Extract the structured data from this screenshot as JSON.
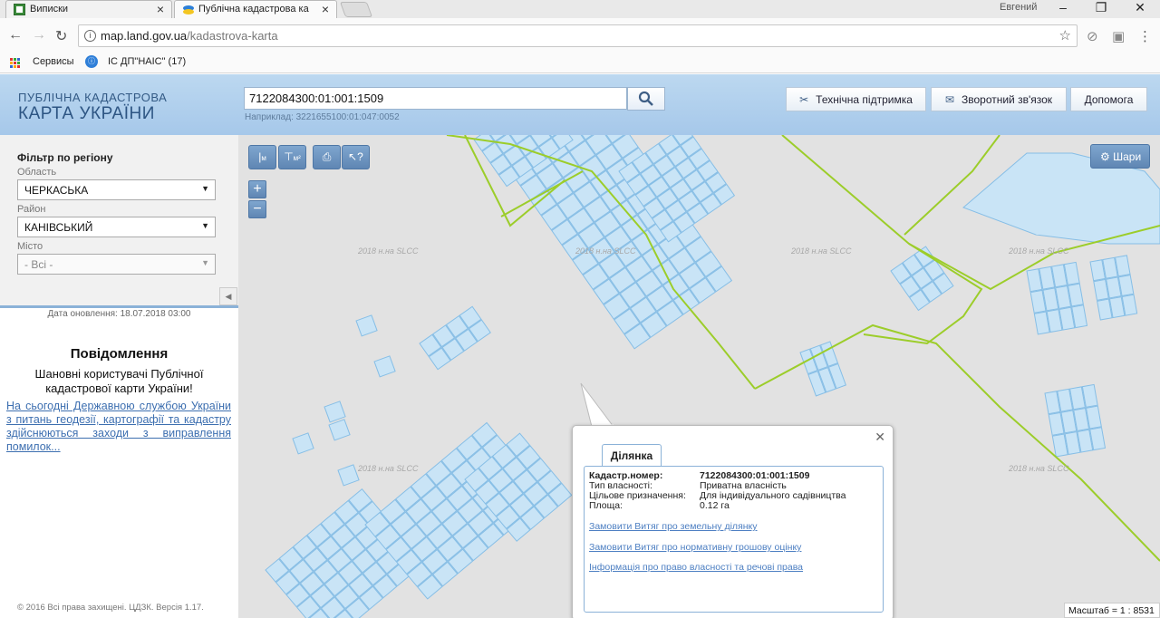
{
  "browser": {
    "tabs": [
      {
        "label": "Виписки"
      },
      {
        "label": "Публічна кадастрова ка"
      }
    ],
    "user": "Евгений",
    "url_host": "map.land.gov.ua",
    "url_path": "/kadastrova-karta",
    "bookmarks": [
      "Сервисы",
      "ІС ДП\"НАІС\" (17)"
    ]
  },
  "header": {
    "logo_line1": "ПУБЛІЧНА КАДАСТРОВА",
    "logo_line2": "КАРТА УКРАЇНИ",
    "search_value": "7122084300:01:001:1509",
    "search_hint": "Наприклад: 3221655100:01:047:0052",
    "buttons": {
      "support": "Технічна підтримка",
      "feedback": "Зворотний зв'язок",
      "help": "Допомога"
    }
  },
  "filter": {
    "title": "Фільтр по регіону",
    "oblast_label": "Область",
    "oblast_value": "ЧЕРКАСЬКА",
    "rayon_label": "Район",
    "rayon_value": "КАНІВСЬКИЙ",
    "city_label": "Місто",
    "city_value": "- Всі -"
  },
  "update_date": "Дата оновлення: 18.07.2018 03:00",
  "notice": {
    "title": "Повідомлення",
    "text": "Шановні користувачі Публічної кадастрової карти України!",
    "link": "На сьогодні Державною службою України з питань геодезії, картографії та кадастру здійснюються заходи з виправлення помилок..."
  },
  "footer": "© 2016 Всі права захищені. ЦДЗК. Версія 1.17.",
  "map": {
    "tools": {
      "measure_m": "м",
      "measure_m2": "м²"
    },
    "layers_label": "Шари",
    "watermark": "2018 н.на SLCC",
    "scale": "Масштаб = 1 : 8531"
  },
  "popup": {
    "tab": "Ділянка",
    "rows": [
      {
        "k": "Кадастр.номер:",
        "v": "7122084300:01:001:1509"
      },
      {
        "k": "Тип власності:",
        "v": "Приватна власність"
      },
      {
        "k": "Цільове призначення:",
        "v": "Для індивідуального садівництва"
      },
      {
        "k": "Площа:",
        "v": "0.12 га"
      }
    ],
    "links": [
      "Замовити Витяг про земельну ділянку",
      "Замовити Витяг про нормативну грошову оцінку",
      "Інформація про право власності та речові права"
    ]
  },
  "colors": {
    "parcel_fill": "#c9e4f6",
    "parcel_stroke": "#86bee6",
    "boundary": "#9ccd2a",
    "header_bg": "#a6c8ea",
    "map_bg": "#e2e2e2"
  }
}
